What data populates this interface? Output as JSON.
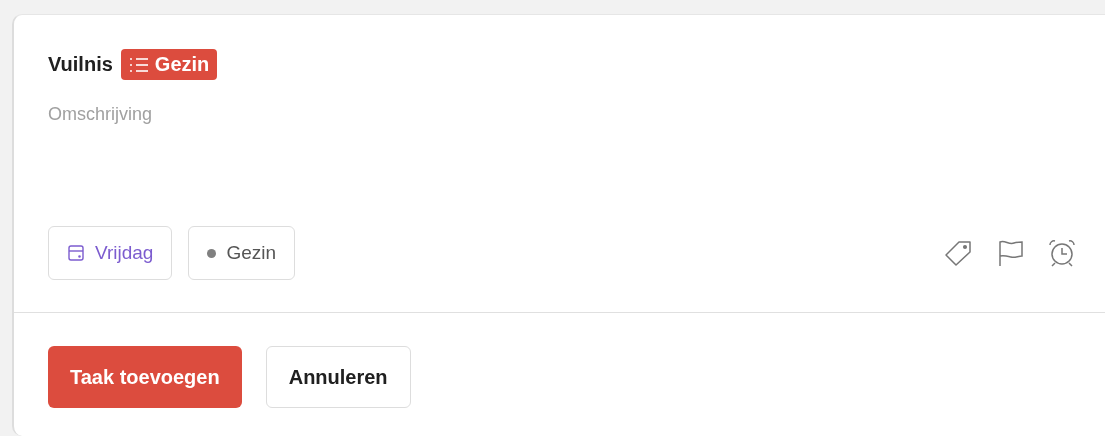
{
  "task": {
    "title": "Vuilnis",
    "project_tag": "Gezin",
    "description_placeholder": "Omschrijving"
  },
  "chips": [
    {
      "kind": "date",
      "label": "Vrijdag"
    },
    {
      "kind": "project",
      "label": "Gezin",
      "color": "#808080"
    }
  ],
  "buttons": [
    {
      "kind": "primary",
      "label": "Taak toevoegen"
    },
    {
      "kind": "secondary",
      "label": "Annuleren"
    }
  ]
}
